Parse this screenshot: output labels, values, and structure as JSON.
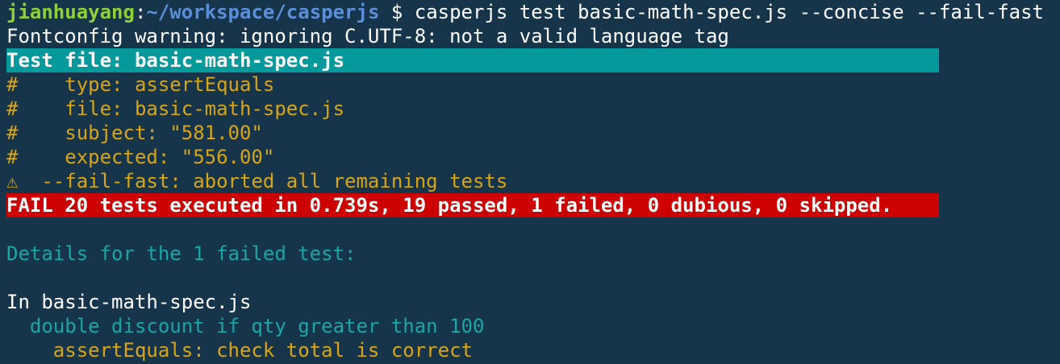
{
  "prompt": {
    "user_host": "jianhuayang",
    "separator": ":",
    "path": "~/workspace/casperjs",
    "symbol": " $ ",
    "command": "casperjs test basic-math-spec.js --concise --fail-fast"
  },
  "lines": {
    "fontconfig_warning": "Fontconfig warning: ignoring C.UTF-8: not a valid language tag",
    "test_file": "Test file: basic-math-spec.js",
    "type_line": "#    type: assertEquals",
    "file_line": "#    file: basic-math-spec.js",
    "subject_line": "#    subject: \"581.00\"",
    "expected_line": "#    expected: \"556.00\"",
    "warning_symbol": "⚠",
    "fail_fast_line": "  --fail-fast: aborted all remaining tests",
    "summary": "FAIL 20 tests executed in 0.739s, 19 passed, 1 failed, 0 dubious, 0 skipped.",
    "details_header": "Details for the 1 failed test:",
    "in_file": "In basic-math-spec.js",
    "test_name": "  double discount if qty greater than 100",
    "assertion": "    assertEquals: check total is correct"
  },
  "colors": {
    "background": "#17354a",
    "band_cyan": "#06999b",
    "band_red": "#cc0000",
    "prompt_green": "#8fd13a",
    "path_blue": "#5b8fd9",
    "comment_yellow": "#d9a514",
    "info_cyan": "#1ba6a6"
  }
}
